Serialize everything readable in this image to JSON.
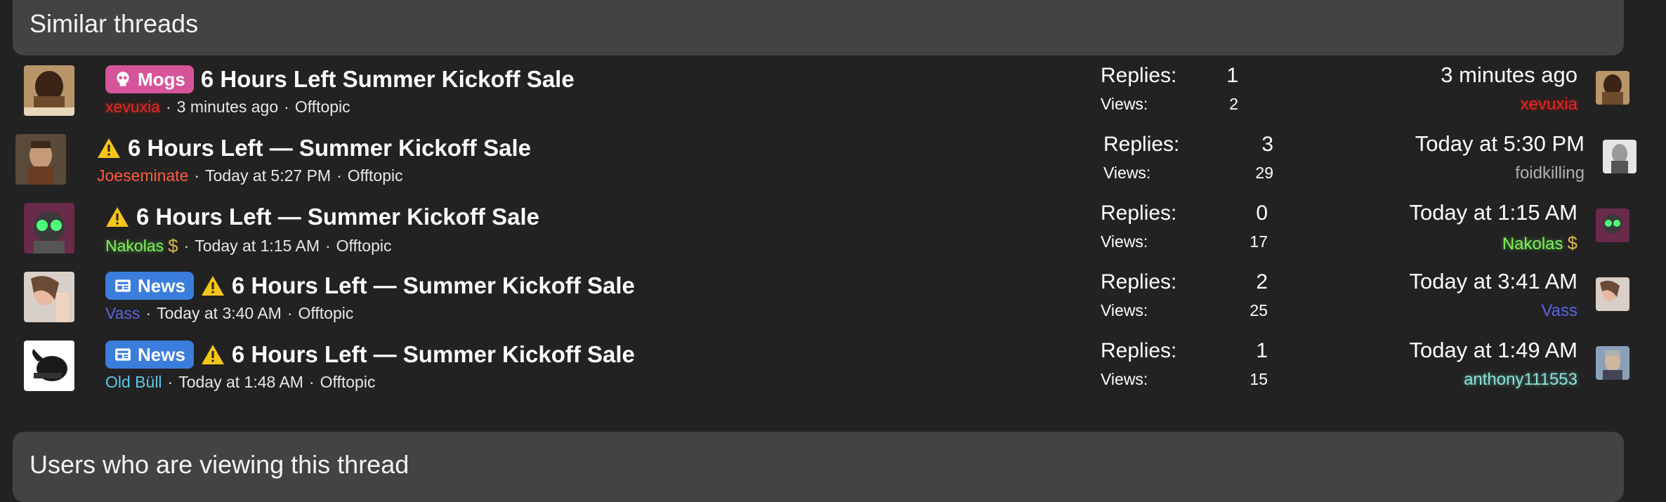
{
  "similar_threads": {
    "heading": "Similar threads",
    "labels": {
      "mogs": "Mogs",
      "news": "News"
    },
    "stats": {
      "replies_label": "Replies:",
      "views_label": "Views:"
    },
    "threads": [
      {
        "label": "Mogs",
        "title": "6 Hours Left Summer Kickoff Sale",
        "author": "xevuxia",
        "posted": "3 minutes ago",
        "forum": "Offtopic",
        "replies": "1",
        "views": "2",
        "last_time": "3 minutes ago",
        "last_user": "xevuxia"
      },
      {
        "title": "6 Hours Left — Summer Kickoff Sale",
        "author": "Joeseminate",
        "posted": "Today at 5:27 PM",
        "forum": "Offtopic",
        "replies": "3",
        "views": "29",
        "last_time": "Today at 5:30 PM",
        "last_user": "foidkilling"
      },
      {
        "title": "6 Hours Left — Summer Kickoff Sale",
        "author": "Nakolas",
        "posted": "Today at 1:15 AM",
        "forum": "Offtopic",
        "replies": "0",
        "views": "17",
        "last_time": "Today at 1:15 AM",
        "last_user": "Nakolas"
      },
      {
        "label": "News",
        "title": "6 Hours Left — Summer Kickoff Sale",
        "author": "Vass",
        "posted": "Today at 3:40 AM",
        "forum": "Offtopic",
        "replies": "2",
        "views": "25",
        "last_time": "Today at 3:41 AM",
        "last_user": "Vass"
      },
      {
        "label": "News",
        "title": "6 Hours Left — Summer Kickoff Sale",
        "author": "Old Büll",
        "posted": "Today at 1:48 AM",
        "forum": "Offtopic",
        "replies": "1",
        "views": "15",
        "last_time": "Today at 1:49 AM",
        "last_user": "anthony111553"
      }
    ],
    "separator": "·",
    "dollar_icon": "$"
  },
  "viewers": {
    "heading": "Users who are viewing this thread"
  },
  "colors": {
    "background": "#222222",
    "header_bg": "#434343",
    "mogs_label": "#d6549a",
    "news_label": "#3b7ddd",
    "warning": "#f5c518"
  }
}
